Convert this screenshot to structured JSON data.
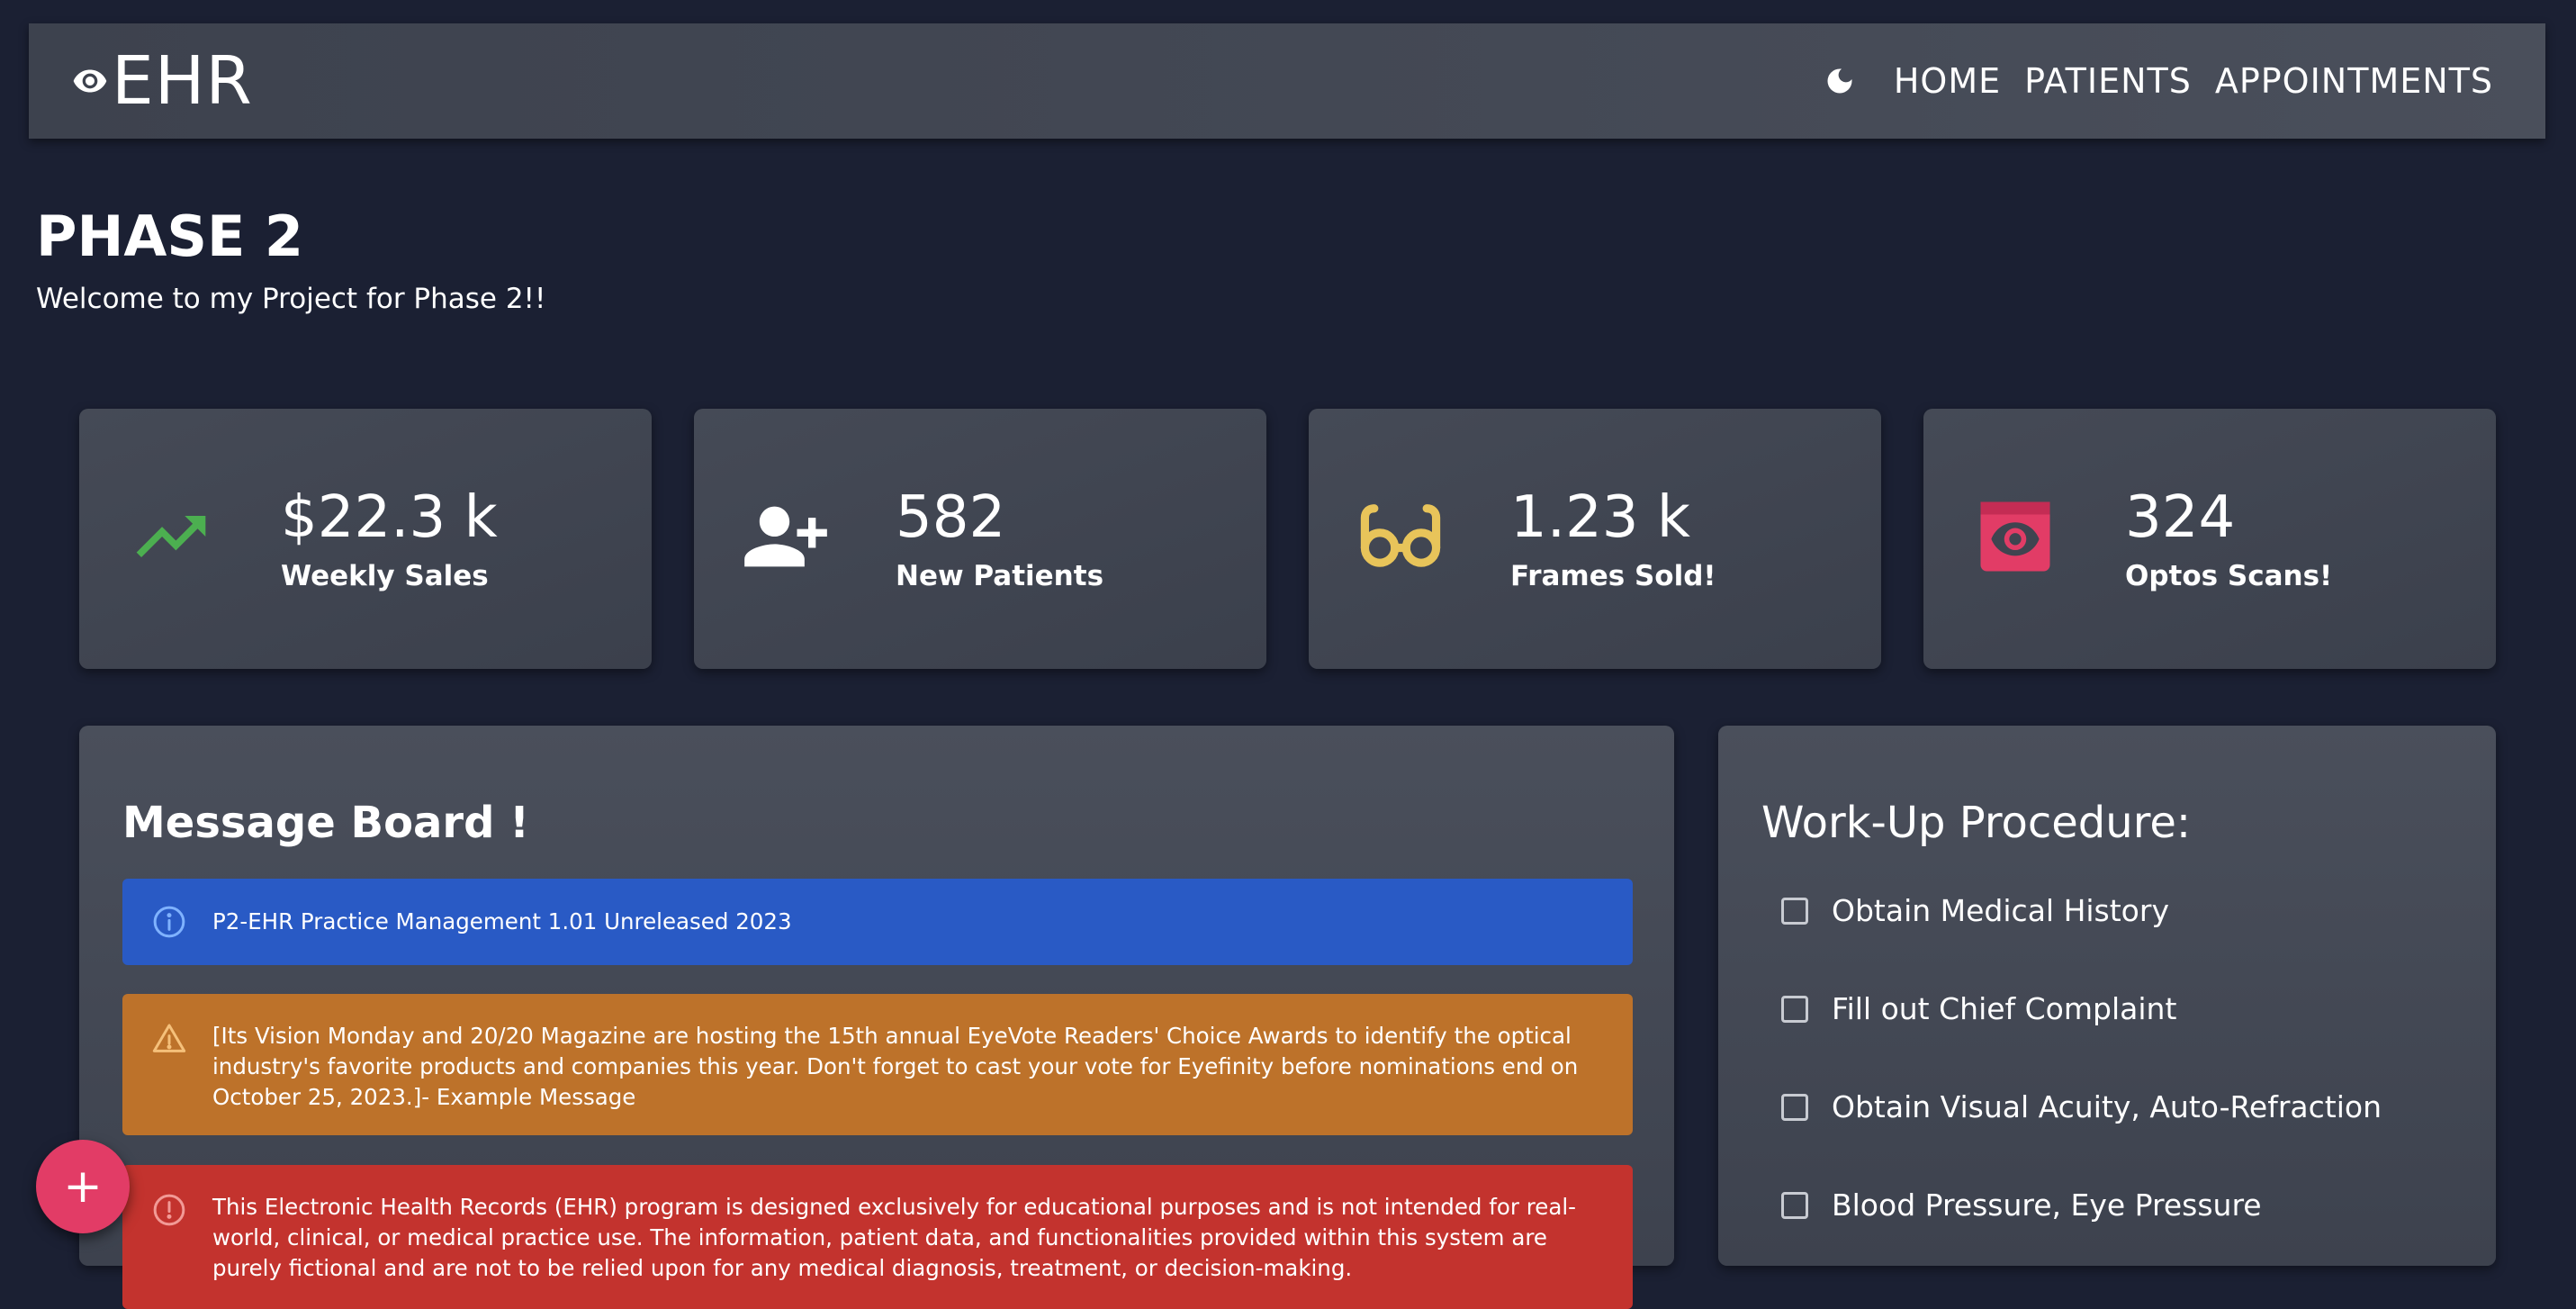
{
  "app": {
    "brand": "EHR"
  },
  "nav": {
    "items": [
      "HOME",
      "PATIENTS",
      "APPOINTMENTS"
    ]
  },
  "page": {
    "title": "PHASE 2",
    "subtitle": "Welcome to my Project for Phase 2!!"
  },
  "stats": [
    {
      "value": "$22.3 k",
      "label": "Weekly Sales",
      "icon": "trending-up-icon",
      "color": "#4caf50"
    },
    {
      "value": "582",
      "label": "New Patients",
      "icon": "person-add-icon",
      "color": "#ffffff"
    },
    {
      "value": "1.23 k",
      "label": "Frames Sold!",
      "icon": "eyeglasses-icon",
      "color": "#e8c45a"
    },
    {
      "value": "324",
      "label": "Optos Scans!",
      "icon": "eye-scan-icon",
      "color": "#e23c66"
    }
  ],
  "message_board": {
    "title": "Message Board !",
    "alerts": [
      {
        "severity": "info",
        "text": "P2-EHR Practice Management 1.01 Unreleased 2023"
      },
      {
        "severity": "warning",
        "text": "[Its Vision Monday and 20/20 Magazine are hosting the 15th annual EyeVote Readers' Choice Awards to identify the optical industry's favorite products and companies this year. Don't forget to cast your vote for Eyefinity before nominations end on October 25, 2023.]- Example Message"
      },
      {
        "severity": "error",
        "text": "This Electronic Health Records (EHR) program is designed exclusively for educational purposes and is not intended for real-world, clinical, or medical practice use. The information, patient data, and functionalities provided within this system are purely fictional and are not to be relied upon for any medical diagnosis, treatment, or decision-making."
      }
    ]
  },
  "workup": {
    "title": "Work-Up Procedure:",
    "items": [
      "Obtain Medical History",
      "Fill out Chief Complaint",
      "Obtain Visual Acuity, Auto-Refraction",
      "Blood Pressure, Eye Pressure"
    ]
  },
  "fab": {
    "label": "+"
  },
  "colors": {
    "background": "#1b2033",
    "info": "#295ac5",
    "warning": "#bd722a",
    "error": "#c3332e",
    "accent": "#e23c66"
  }
}
